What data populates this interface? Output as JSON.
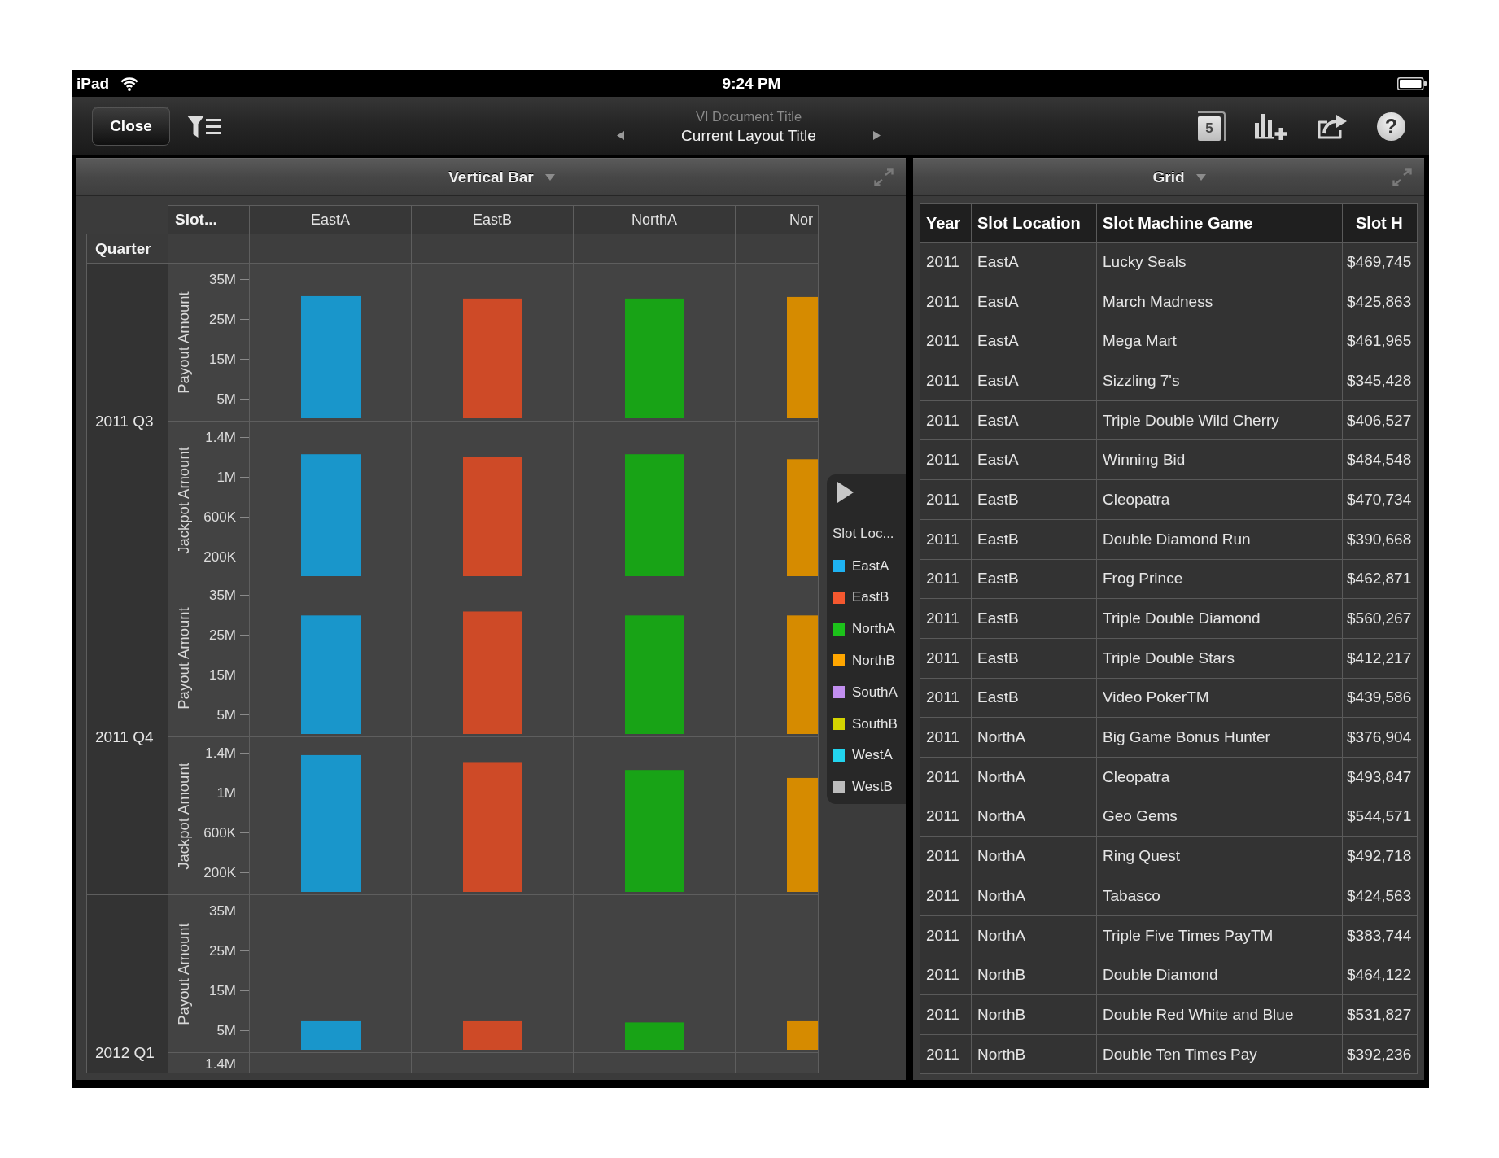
{
  "status_bar": {
    "device": "iPad",
    "time": "9:24 PM"
  },
  "toolbar": {
    "close_button": "Close",
    "document_title": "VI Document Title",
    "layout_title": "Current Layout Title",
    "page_count": "5",
    "help_button": "?"
  },
  "chart_panel": {
    "title": "Vertical Bar",
    "column_header": "Slot...",
    "columns": [
      "EastA",
      "EastB",
      "NorthA",
      "Nor"
    ],
    "row_header": "Quarter",
    "rows": [
      {
        "quarter": "2011 Q3",
        "panels": [
          {
            "chart_data": {
              "type": "bar",
              "ylabel": "Payout Amount",
              "grid": true,
              "ylim": [
                0,
                39000000
              ],
              "yticks": [
                {
                  "value": 35000000,
                  "label": "35M"
                },
                {
                  "value": 25000000,
                  "label": "25M"
                },
                {
                  "value": 15000000,
                  "label": "15M"
                },
                {
                  "value": 5000000,
                  "label": "5M"
                }
              ],
              "values": [
                30800000,
                30200000,
                30200000,
                30600000
              ]
            }
          },
          {
            "chart_data": {
              "type": "bar",
              "ylabel": "Jackpot Amount",
              "grid": true,
              "ylim": [
                0,
                1560000
              ],
              "yticks": [
                {
                  "value": 1400000,
                  "label": "1.4M"
                },
                {
                  "value": 1000000,
                  "label": "1M"
                },
                {
                  "value": 600000,
                  "label": "600K"
                },
                {
                  "value": 200000,
                  "label": "200K"
                }
              ],
              "values": [
                1230000,
                1200000,
                1230000,
                1180000
              ]
            }
          }
        ]
      },
      {
        "quarter": "2011 Q4",
        "panels": [
          {
            "chart_data": {
              "type": "bar",
              "ylabel": "Payout Amount",
              "grid": true,
              "ylim": [
                0,
                39000000
              ],
              "yticks": [
                {
                  "value": 35000000,
                  "label": "35M"
                },
                {
                  "value": 25000000,
                  "label": "25M"
                },
                {
                  "value": 15000000,
                  "label": "15M"
                },
                {
                  "value": 5000000,
                  "label": "5M"
                }
              ],
              "values": [
                29900000,
                30900000,
                29900000,
                29900000
              ]
            }
          },
          {
            "chart_data": {
              "type": "bar",
              "ylabel": "Jackpot Amount",
              "grid": true,
              "ylim": [
                0,
                1560000
              ],
              "yticks": [
                {
                  "value": 1400000,
                  "label": "1.4M"
                },
                {
                  "value": 1000000,
                  "label": "1M"
                },
                {
                  "value": 600000,
                  "label": "600K"
                },
                {
                  "value": 200000,
                  "label": "200K"
                }
              ],
              "values": [
                1380000,
                1310000,
                1230000,
                1150000
              ]
            }
          }
        ]
      },
      {
        "quarter": "2012 Q1",
        "panels": [
          {
            "chart_data": {
              "type": "bar",
              "ylabel": "Payout Amount",
              "grid": true,
              "ylim": [
                0,
                39000000
              ],
              "yticks": [
                {
                  "value": 35000000,
                  "label": "35M"
                },
                {
                  "value": 25000000,
                  "label": "25M"
                },
                {
                  "value": 15000000,
                  "label": "15M"
                },
                {
                  "value": 5000000,
                  "label": "5M"
                }
              ],
              "values": [
                7200000,
                7200000,
                6900000,
                7200000
              ]
            }
          },
          {
            "partial_tick": "1.4M"
          }
        ]
      }
    ],
    "legend": {
      "title": "Slot Loc...",
      "items": [
        {
          "label": "EastA",
          "color": "#1eb2f2"
        },
        {
          "label": "EastB",
          "color": "#f5582f"
        },
        {
          "label": "NorthA",
          "color": "#1cc21a"
        },
        {
          "label": "NorthB",
          "color": "#ffa600"
        },
        {
          "label": "SouthA",
          "color": "#c28ff0"
        },
        {
          "label": "SouthB",
          "color": "#d4d400"
        },
        {
          "label": "WestA",
          "color": "#22d4ee"
        },
        {
          "label": "WestB",
          "color": "#bdbdbd"
        }
      ]
    }
  },
  "grid_panel": {
    "title": "Grid",
    "columns": [
      "Year",
      "Slot Location",
      "Slot Machine Game",
      "Slot H"
    ],
    "rows": [
      [
        "2011",
        "EastA",
        "Lucky Seals",
        "$469,745"
      ],
      [
        "2011",
        "EastA",
        "March Madness",
        "$425,863"
      ],
      [
        "2011",
        "EastA",
        "Mega Mart",
        "$461,965"
      ],
      [
        "2011",
        "EastA",
        "Sizzling 7's",
        "$345,428"
      ],
      [
        "2011",
        "EastA",
        "Triple Double Wild Cherry",
        "$406,527"
      ],
      [
        "2011",
        "EastA",
        "Winning Bid",
        "$484,548"
      ],
      [
        "2011",
        "EastB",
        "Cleopatra",
        "$470,734"
      ],
      [
        "2011",
        "EastB",
        "Double Diamond Run",
        "$390,668"
      ],
      [
        "2011",
        "EastB",
        "Frog Prince",
        "$462,871"
      ],
      [
        "2011",
        "EastB",
        "Triple Double Diamond",
        "$560,267"
      ],
      [
        "2011",
        "EastB",
        "Triple Double Stars",
        "$412,217"
      ],
      [
        "2011",
        "EastB",
        "Video PokerTM",
        "$439,586"
      ],
      [
        "2011",
        "NorthA",
        "Big Game Bonus Hunter",
        "$376,904"
      ],
      [
        "2011",
        "NorthA",
        "Cleopatra",
        "$493,847"
      ],
      [
        "2011",
        "NorthA",
        "Geo Gems",
        "$544,571"
      ],
      [
        "2011",
        "NorthA",
        "Ring Quest",
        "$492,718"
      ],
      [
        "2011",
        "NorthA",
        "Tabasco",
        "$424,563"
      ],
      [
        "2011",
        "NorthA",
        "Triple Five Times PayTM",
        "$383,744"
      ],
      [
        "2011",
        "NorthB",
        "Double Diamond",
        "$464,122"
      ],
      [
        "2011",
        "NorthB",
        "Double Red White and Blue",
        "$531,827"
      ],
      [
        "2011",
        "NorthB",
        "Double Ten Times Pay",
        "$392,236"
      ]
    ]
  }
}
